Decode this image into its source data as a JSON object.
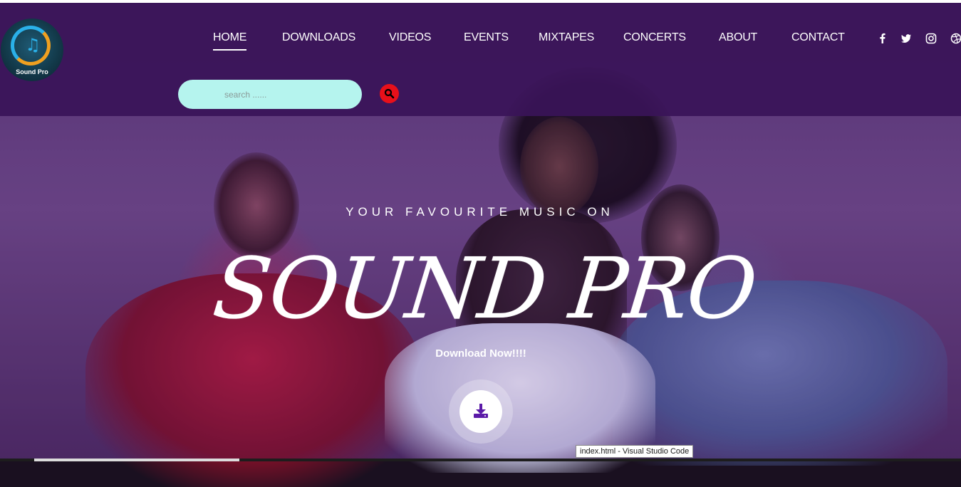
{
  "brand": {
    "logo_text": "Sound Pro"
  },
  "nav": {
    "items": [
      {
        "label": "HOME",
        "active": true
      },
      {
        "label": "DOWNLOADS",
        "active": false
      },
      {
        "label": "VIDEOS",
        "active": false
      },
      {
        "label": "EVENTS",
        "active": false
      },
      {
        "label": "MIXTAPES",
        "active": false
      },
      {
        "label": "CONCERTS",
        "active": false
      },
      {
        "label": "ABOUT",
        "active": false
      },
      {
        "label": "CONTACT",
        "active": false
      }
    ]
  },
  "social": {
    "icons": [
      "facebook-icon",
      "twitter-icon",
      "instagram-icon",
      "dribbble-icon"
    ]
  },
  "search": {
    "placeholder": "search ......",
    "value": ""
  },
  "hero": {
    "subtitle": "YOUR FAVOURITE MUSIC ON",
    "title": "SOUND PRO",
    "cta_text": "Download Now!!!!"
  },
  "tooltip": {
    "text": "index.html - Visual Studio Code"
  },
  "colors": {
    "header_bg": "#3a1458",
    "search_bg": "#b5f4ee",
    "search_button": "#e8101a",
    "download_icon": "#5b1aa8"
  }
}
